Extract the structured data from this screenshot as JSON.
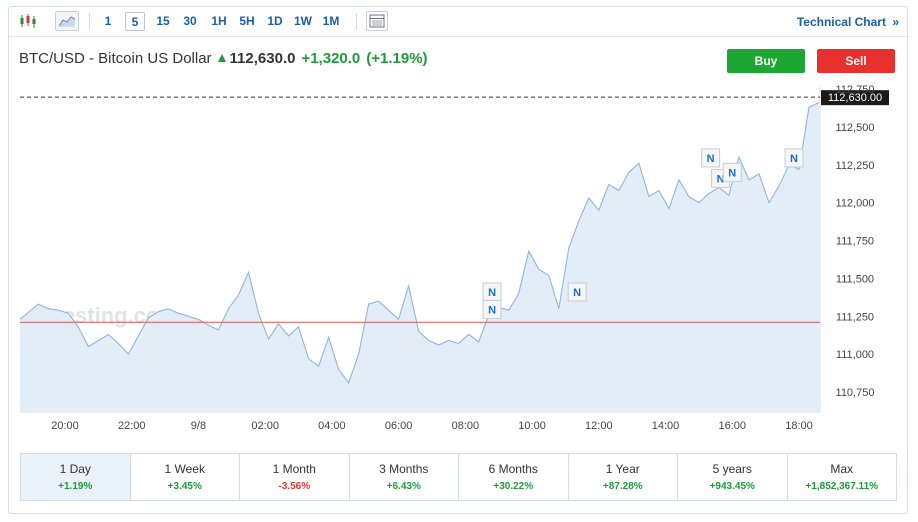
{
  "toolbar": {
    "chart_type_icons": [
      "candlestick-icon",
      "area-chart-icon"
    ],
    "intervals": [
      "1",
      "5",
      "15",
      "30",
      "1H",
      "5H",
      "1D",
      "1W",
      "1M"
    ],
    "active_interval": "5",
    "table_icon": "table-icon",
    "technical_chart_label": "Technical Chart",
    "technical_chart_arrow": "»"
  },
  "quote": {
    "name": "BTC/USD - Bitcoin US Dollar",
    "price": "112,630.0",
    "change": "+1,320.0",
    "change_pct": "(+1.19%)",
    "direction": "up"
  },
  "actions": {
    "buy_label": "Buy",
    "sell_label": "Sell"
  },
  "chart_data": {
    "type": "area",
    "watermark": "Investing.com",
    "x_ticks": [
      "20:00",
      "22:00",
      "9/8",
      "02:00",
      "04:00",
      "06:00",
      "08:00",
      "10:00",
      "12:00",
      "14:00",
      "16:00",
      "18:00"
    ],
    "y_ticks": [
      "112,750",
      "112,500",
      "112,250",
      "112,000",
      "111,750",
      "111,500",
      "111,250",
      "111,000",
      "110,750"
    ],
    "ylim": [
      110,
      650,
      112,
      850
    ],
    "current_price_label": "112,630.00",
    "current_price": 112630,
    "previous_close": 111210,
    "series": [
      {
        "hours": [
          18.85,
          19.2,
          19.5,
          19.8,
          20.1,
          20.4,
          20.7,
          21.0,
          21.3,
          21.6,
          21.9,
          22.2,
          22.5,
          22.8,
          23.1,
          23.4,
          23.7,
          24.0,
          24.3,
          24.6,
          24.9,
          25.2,
          25.5,
          25.8,
          26.1,
          26.4,
          26.7,
          27.0,
          27.3,
          27.6,
          27.9,
          28.2,
          28.5,
          28.8,
          29.1,
          29.4,
          29.7,
          30.0,
          30.3,
          30.6,
          30.9,
          31.2,
          31.5,
          31.8,
          32.1,
          32.4,
          32.7,
          33.0,
          33.3,
          33.6,
          33.9,
          34.2,
          34.5,
          34.8,
          35.1,
          35.4,
          35.7,
          36.0,
          36.3,
          36.6,
          36.9,
          37.2,
          37.5,
          37.8,
          38.1,
          38.4,
          38.7,
          39.0,
          39.3,
          39.6,
          39.9,
          40.2,
          40.5,
          40.8,
          41.1,
          41.4,
          41.7,
          42.0,
          42.3,
          42.6
        ],
        "values": [
          111230,
          111330,
          111300,
          111290,
          111270,
          111180,
          111050,
          111090,
          111130,
          111070,
          111000,
          111120,
          111240,
          111280,
          111300,
          111270,
          111250,
          111230,
          111190,
          111160,
          111300,
          111390,
          111540,
          111270,
          111100,
          111200,
          111120,
          111180,
          110970,
          110920,
          111110,
          110900,
          110810,
          111000,
          111330,
          111350,
          111290,
          111230,
          111450,
          111150,
          111090,
          111060,
          111090,
          111070,
          111130,
          111080,
          111260,
          111310,
          111290,
          111400,
          111680,
          111560,
          111520,
          111300,
          111700,
          111880,
          112030,
          111950,
          112120,
          112080,
          112200,
          112260,
          112040,
          112080,
          111960,
          112150,
          112040,
          112000,
          112060,
          112100,
          112050,
          112300,
          112150,
          112190,
          112000,
          112110,
          112250,
          112220,
          112630,
          112660
        ]
      }
    ],
    "news_markers": [
      {
        "hour": 32.8,
        "value": 111410,
        "label": "N"
      },
      {
        "hour": 32.8,
        "value": 111295,
        "label": "N"
      },
      {
        "hour": 35.35,
        "value": 111410,
        "label": "N"
      },
      {
        "hour": 39.35,
        "value": 112295,
        "label": "N"
      },
      {
        "hour": 39.65,
        "value": 112160,
        "label": "N"
      },
      {
        "hour": 40.0,
        "value": 112200,
        "label": "N"
      },
      {
        "hour": 41.85,
        "value": 112295,
        "label": "N"
      }
    ]
  },
  "periods": [
    {
      "label": "1 Day",
      "value": "+1.19%",
      "sign": "pos",
      "active": true
    },
    {
      "label": "1 Week",
      "value": "+3.45%",
      "sign": "pos",
      "active": false
    },
    {
      "label": "1 Month",
      "value": "-3.56%",
      "sign": "neg",
      "active": false
    },
    {
      "label": "3 Months",
      "value": "+6.43%",
      "sign": "pos",
      "active": false
    },
    {
      "label": "6 Months",
      "value": "+30.22%",
      "sign": "pos",
      "active": false
    },
    {
      "label": "1 Year",
      "value": "+87.28%",
      "sign": "pos",
      "active": false
    },
    {
      "label": "5 years",
      "value": "+943.45%",
      "sign": "pos",
      "active": false
    },
    {
      "label": "Max",
      "value": "+1,852,367.11%",
      "sign": "pos",
      "active": false
    }
  ],
  "colors": {
    "accent": "#1a5fa8",
    "up": "#1e9b3a",
    "down": "#e8312f",
    "line": "#8fb6dd",
    "area": "#e3edf7",
    "prev_close": "#e05555"
  }
}
